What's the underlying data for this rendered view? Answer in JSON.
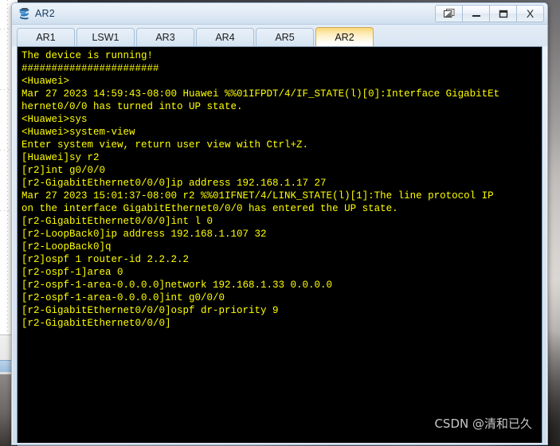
{
  "window": {
    "title": "AR2",
    "app_icon": "router-device-icon",
    "controls": [
      {
        "name": "restore-windows-button",
        "icon": "cascade-windows-icon",
        "label": ""
      },
      {
        "name": "minimize-button",
        "icon": "minimize-icon",
        "label": ""
      },
      {
        "name": "maximize-button",
        "icon": "maximize-icon",
        "label": ""
      },
      {
        "name": "close-button",
        "icon": "close-icon",
        "label": "X"
      }
    ]
  },
  "tabs": [
    {
      "label": "AR1",
      "active": false
    },
    {
      "label": "LSW1",
      "active": false
    },
    {
      "label": "AR3",
      "active": false
    },
    {
      "label": "AR4",
      "active": false
    },
    {
      "label": "AR5",
      "active": false
    },
    {
      "label": "AR2",
      "active": true
    }
  ],
  "terminal": {
    "foreground_color": "#ffff00",
    "background_color": "#000000",
    "lines": [
      "The device is running!",
      "#######################",
      "<Huawei>",
      "Mar 27 2023 14:59:43-08:00 Huawei %%01IFPDT/4/IF_STATE(l)[0]:Interface GigabitEt",
      "hernet0/0/0 has turned into UP state.",
      "<Huawei>sys",
      "<Huawei>system-view",
      "Enter system view, return user view with Ctrl+Z.",
      "[Huawei]sy r2",
      "[r2]int g0/0/0",
      "[r2-GigabitEthernet0/0/0]ip address 192.168.1.17 27",
      "Mar 27 2023 15:01:37-08:00 r2 %%01IFNET/4/LINK_STATE(l)[1]:The line protocol IP",
      "on the interface GigabitEthernet0/0/0 has entered the UP state.",
      "[r2-GigabitEthernet0/0/0]int l 0",
      "[r2-LoopBack0]ip address 192.168.1.107 32",
      "[r2-LoopBack0]q",
      "[r2]ospf 1 router-id 2.2.2.2",
      "[r2-ospf-1]area 0",
      "[r2-ospf-1-area-0.0.0.0]network 192.168.1.33 0.0.0.0",
      "[r2-ospf-1-area-0.0.0.0]int g0/0/0",
      "[r2-GigabitEthernet0/0/0]ospf dr-priority 9",
      "[r2-GigabitEthernet0/0/0]"
    ]
  },
  "watermark": {
    "text": "CSDN @清和已久"
  }
}
